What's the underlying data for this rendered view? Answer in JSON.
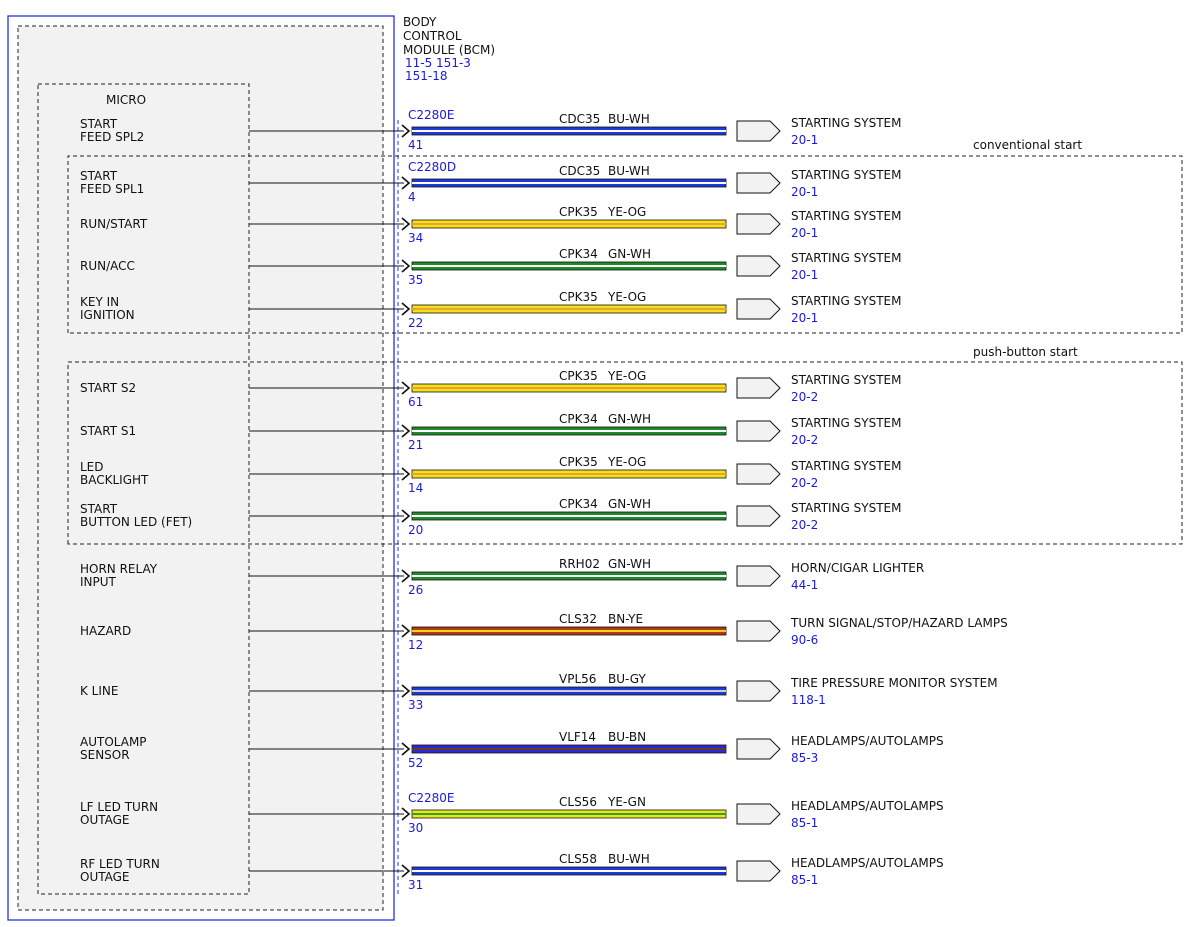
{
  "module": {
    "title_lines": [
      "BODY",
      "CONTROL",
      "MODULE (BCM)"
    ],
    "ref_lines": [
      "11-5  151-3",
      "151-18"
    ],
    "micro_label": "MICRO"
  },
  "groups": {
    "conventional": "conventional start",
    "push_button": "push-button start"
  },
  "circuits": [
    {
      "pin_label": [
        "START",
        "FEED SPL2"
      ],
      "connector": "C2280E",
      "pin": "41",
      "circuit": "CDC35",
      "color_code": "BU-WH",
      "wire_colors": [
        "#1f3ad6",
        "#ffffff"
      ],
      "dest": "STARTING SYSTEM",
      "dest_ref": "20-1"
    },
    {
      "pin_label": [
        "START",
        "FEED SPL1"
      ],
      "connector": "C2280D",
      "pin": "4",
      "circuit": "CDC35",
      "color_code": "BU-WH",
      "wire_colors": [
        "#1f3ad6",
        "#ffffff"
      ],
      "dest": "STARTING SYSTEM",
      "dest_ref": "20-1"
    },
    {
      "pin_label": [
        "RUN/START"
      ],
      "connector": "",
      "pin": "34",
      "circuit": "CPK35",
      "color_code": "YE-OG",
      "wire_colors": [
        "#f2e21a",
        "#f0a030"
      ],
      "dest": "STARTING SYSTEM",
      "dest_ref": "20-1"
    },
    {
      "pin_label": [
        "RUN/ACC"
      ],
      "connector": "",
      "pin": "35",
      "circuit": "CPK34",
      "color_code": "GN-WH",
      "wire_colors": [
        "#1f8a2a",
        "#ffffff"
      ],
      "dest": "STARTING SYSTEM",
      "dest_ref": "20-1"
    },
    {
      "pin_label": [
        "KEY IN",
        "IGNITION"
      ],
      "connector": "",
      "pin": "22",
      "circuit": "CPK35",
      "color_code": "YE-OG",
      "wire_colors": [
        "#f2e21a",
        "#f0a030"
      ],
      "dest": "STARTING SYSTEM",
      "dest_ref": "20-1"
    },
    {
      "pin_label": [
        "START S2"
      ],
      "connector": "",
      "pin": "61",
      "circuit": "CPK35",
      "color_code": "YE-OG",
      "wire_colors": [
        "#f2e21a",
        "#f0a030"
      ],
      "dest": "STARTING SYSTEM",
      "dest_ref": "20-2"
    },
    {
      "pin_label": [
        "START S1"
      ],
      "connector": "",
      "pin": "21",
      "circuit": "CPK34",
      "color_code": "GN-WH",
      "wire_colors": [
        "#1f8a2a",
        "#ffffff"
      ],
      "dest": "STARTING SYSTEM",
      "dest_ref": "20-2"
    },
    {
      "pin_label": [
        "LED",
        "BACKLIGHT"
      ],
      "connector": "",
      "pin": "14",
      "circuit": "CPK35",
      "color_code": "YE-OG",
      "wire_colors": [
        "#f2e21a",
        "#f0a030"
      ],
      "dest": "STARTING SYSTEM",
      "dest_ref": "20-2"
    },
    {
      "pin_label": [
        "START",
        "BUTTON LED (FET)"
      ],
      "connector": "",
      "pin": "20",
      "circuit": "CPK34",
      "color_code": "GN-WH",
      "wire_colors": [
        "#1f8a2a",
        "#ffffff"
      ],
      "dest": "STARTING SYSTEM",
      "dest_ref": "20-2"
    },
    {
      "pin_label": [
        "HORN RELAY",
        "INPUT"
      ],
      "connector": "",
      "pin": "26",
      "circuit": "RRH02",
      "color_code": "GN-WH",
      "wire_colors": [
        "#1f8a2a",
        "#ffffff"
      ],
      "dest": "HORN/CIGAR LIGHTER",
      "dest_ref": "44-1"
    },
    {
      "pin_label": [
        "HAZARD"
      ],
      "connector": "",
      "pin": "12",
      "circuit": "CLS32",
      "color_code": "BN-YE",
      "wire_colors": [
        "#b33a12",
        "#f2d21a"
      ],
      "dest": "TURN SIGNAL/STOP/HAZARD LAMPS",
      "dest_ref": "90-6"
    },
    {
      "pin_label": [
        "K LINE"
      ],
      "connector": "",
      "pin": "33",
      "circuit": "VPL56",
      "color_code": "BU-GY",
      "wire_colors": [
        "#1f3ad6",
        "#cfcfcf"
      ],
      "dest": "TIRE PRESSURE MONITOR SYSTEM",
      "dest_ref": "118-1"
    },
    {
      "pin_label": [
        "AUTOLAMP",
        "SENSOR"
      ],
      "connector": "",
      "pin": "52",
      "circuit": "VLF14",
      "color_code": "BU-BN",
      "wire_colors": [
        "#2a2ad6",
        "#6a3a1a"
      ],
      "dest": "HEADLAMPS/AUTOLAMPS",
      "dest_ref": "85-3"
    },
    {
      "pin_label": [
        "LF LED TURN",
        "OUTAGE"
      ],
      "connector": "C2280E",
      "pin": "30",
      "circuit": "CLS56",
      "color_code": "YE-GN",
      "wire_colors": [
        "#e8e81a",
        "#3a9a2a"
      ],
      "dest": "HEADLAMPS/AUTOLAMPS",
      "dest_ref": "85-1"
    },
    {
      "pin_label": [
        "RF LED TURN",
        "OUTAGE"
      ],
      "connector": "",
      "pin": "31",
      "circuit": "CLS58",
      "color_code": "BU-WH",
      "wire_colors": [
        "#1f3ad6",
        "#ffffff"
      ],
      "dest": "HEADLAMPS/AUTOLAMPS",
      "dest_ref": "85-1"
    }
  ]
}
